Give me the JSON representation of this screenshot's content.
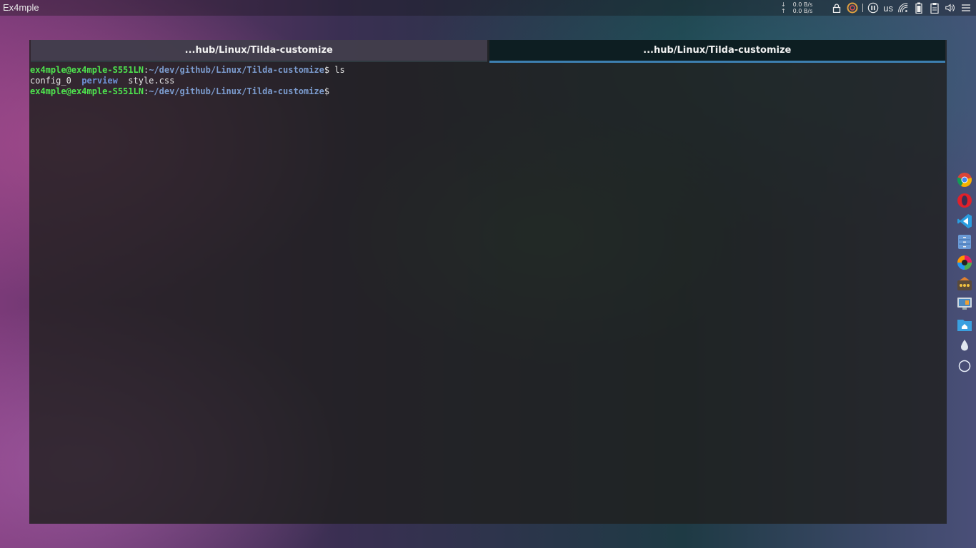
{
  "top_panel": {
    "app_title": "Ex4mple",
    "net_down": "0.0 B/s",
    "net_up": "0.0 B/s",
    "down_arrow": "↓",
    "up_arrow": "↑",
    "keyboard_layout": "us",
    "icons": [
      "lock-icon",
      "power-ring-icon",
      "media-pause-icon",
      "wifi-icon",
      "battery-icon",
      "clipboard-icon",
      "volume-icon",
      "menu-icon"
    ]
  },
  "terminal": {
    "tabs": [
      {
        "label": "...hub/Linux/Tilda-customize",
        "active": false
      },
      {
        "label": "...hub/Linux/Tilda-customize",
        "active": true
      }
    ],
    "lines": [
      {
        "user": "ex4mple@ex4mple-S551LN",
        "sep": ":",
        "path": "~/dev/github/Linux/Tilda-customize",
        "symbol": "$",
        "command": " ls"
      },
      {
        "output": [
          "config_0",
          "perview",
          "style.css"
        ]
      },
      {
        "user": "ex4mple@ex4mple-S551LN",
        "sep": ":",
        "path": "~/dev/github/Linux/Tilda-customize",
        "symbol": "$",
        "command": ""
      }
    ]
  },
  "dock": {
    "items": [
      "chrome-icon",
      "opera-icon",
      "vscode-icon",
      "file-cabinet-icon",
      "color-picker-icon",
      "app-store-icon",
      "screen-display-icon",
      "home-folder-icon",
      "drop-icon",
      "circle-icon"
    ]
  },
  "colors": {
    "prompt_user": "#4ee44e",
    "prompt_path": "#7c9ccf",
    "directory": "#6f92d6",
    "active_tab_border": "#3d7fb0"
  }
}
